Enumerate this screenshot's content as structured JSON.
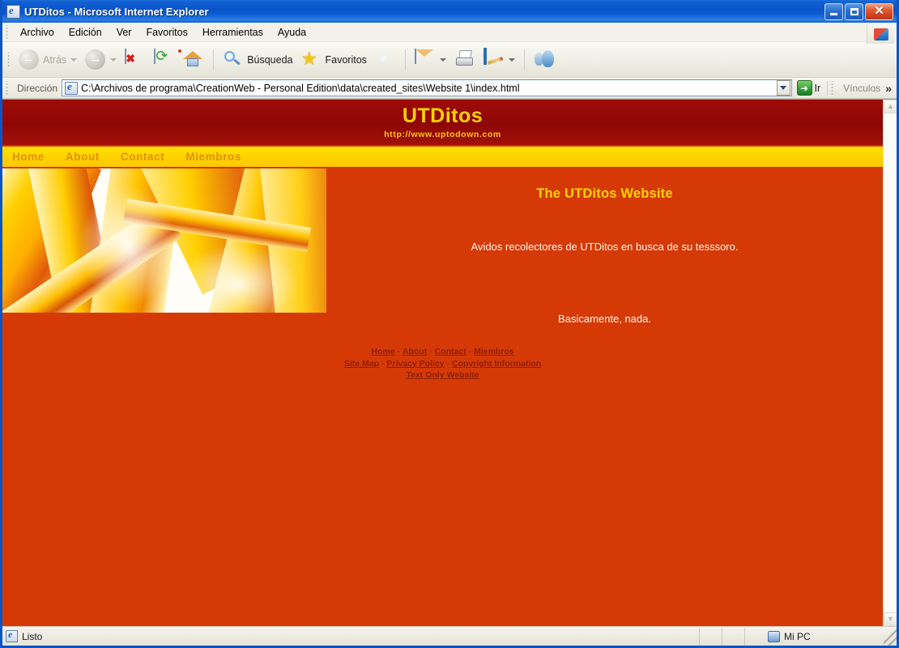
{
  "window": {
    "title": "UTDitos - Microsoft Internet Explorer",
    "icon": "ie-document-icon",
    "minimize_label": "",
    "restore_label": "",
    "close_label": "✕"
  },
  "menubar": {
    "items": [
      {
        "label": "Archivo"
      },
      {
        "label": "Edición"
      },
      {
        "label": "Ver"
      },
      {
        "label": "Favoritos"
      },
      {
        "label": "Herramientas"
      },
      {
        "label": "Ayuda"
      }
    ]
  },
  "toolbar": {
    "back_label": "Atrás",
    "forward_label": "",
    "stop_label": "",
    "refresh_label": "",
    "home_label": "",
    "search_label": "Búsqueda",
    "favorites_label": "Favoritos",
    "history_label": "",
    "mail_label": "",
    "print_label": "",
    "edit_label": "",
    "messenger_label": ""
  },
  "address": {
    "label": "Dirección",
    "value": "C:\\Archivos de programa\\CreationWeb - Personal Edition\\data\\created_sites\\Website 1\\index.html",
    "placeholder": "",
    "go_label": "Ir",
    "go_glyph": "➜",
    "links_label": "Vínculos",
    "chevron": "»"
  },
  "site": {
    "banner_title": "UTDitos",
    "banner_url": "http://www.uptodown.com",
    "nav": [
      {
        "label": "Home"
      },
      {
        "label": "About"
      },
      {
        "label": "Contact"
      },
      {
        "label": "Miembros"
      }
    ],
    "heading": "The UTDitos Website",
    "paragraph_1": "Avidos recolectores de UTDitos en busca de su tesssoro.",
    "paragraph_2": "Basicamente, nada.",
    "footer": {
      "row_1": [
        {
          "label": "Home"
        },
        {
          "label": "About"
        },
        {
          "label": "Contact"
        },
        {
          "label": "Miembros"
        }
      ],
      "row_2": [
        {
          "label": "Site Map"
        },
        {
          "label": "Privacy Policy"
        },
        {
          "label": "Copyright Information"
        }
      ],
      "row_3": [
        {
          "label": "Text Only Website"
        }
      ],
      "separator": " - "
    },
    "colors": {
      "page_background": "#d53a06",
      "banner_background": "#8e0705",
      "banner_title_color": "#ffd400",
      "nav_background": "#ffd400",
      "nav_link_color": "#e09000",
      "heading_color": "#ffd400",
      "body_text_color": "#fff6ec",
      "footer_link_color": "#8e1f04"
    },
    "hero_image_alt": "golden-ribbons-abstract-image"
  },
  "scrollbar": {
    "up_arrow": "▲",
    "down_arrow": "▼"
  },
  "statusbar": {
    "status_text": "Listo",
    "zone_text": "Mi PC"
  }
}
